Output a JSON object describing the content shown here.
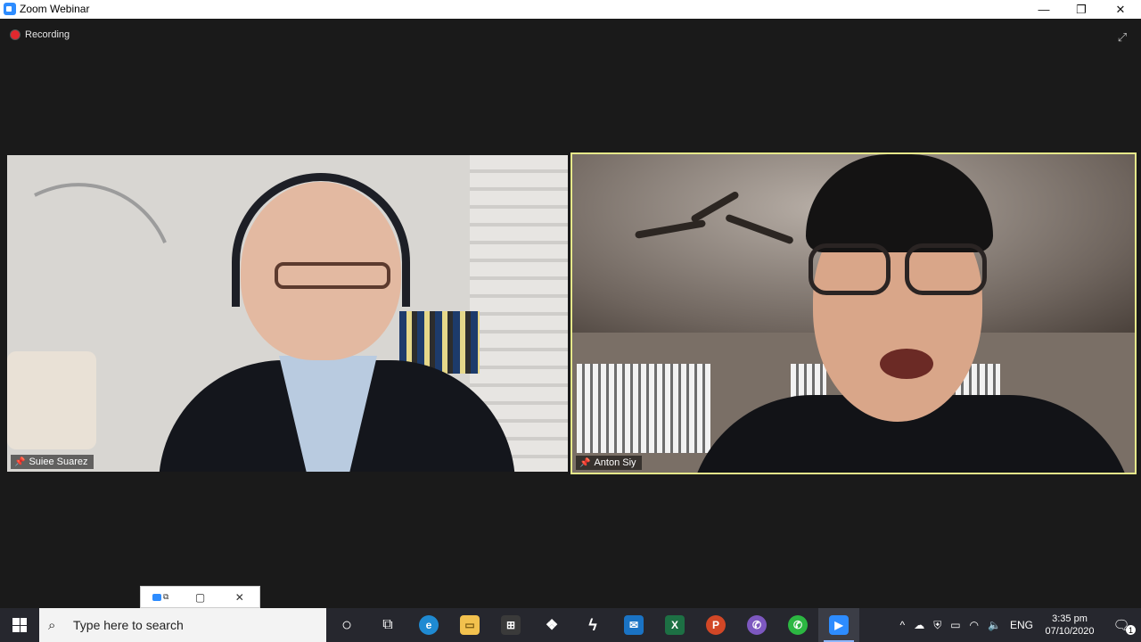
{
  "window": {
    "title": "Zoom Webinar",
    "minimize": "—",
    "maximize": "❐",
    "close": "✕"
  },
  "meeting": {
    "recording_label": "Recording",
    "fullscreen_icon": "⤢",
    "participants": [
      {
        "name": "Suiee Suarez",
        "speaking": false
      },
      {
        "name": "Anton Siy",
        "speaking": true
      }
    ],
    "active_speaker_border": "#e6e88a",
    "recording_color": "#e0282e"
  },
  "mini_controls": {
    "restore_icon": "▢",
    "close_icon": "✕"
  },
  "taskbar": {
    "search_placeholder": "Type here to search",
    "apps": [
      {
        "name": "cortana",
        "glyph": "○"
      },
      {
        "name": "task-view",
        "glyph": "⧉"
      },
      {
        "name": "edge",
        "glyph": "e"
      },
      {
        "name": "file-explorer",
        "glyph": "▭"
      },
      {
        "name": "store",
        "glyph": "⊞"
      },
      {
        "name": "dropbox",
        "glyph": "❖"
      },
      {
        "name": "app-bolt",
        "glyph": "ϟ"
      },
      {
        "name": "mail",
        "glyph": "✉"
      },
      {
        "name": "excel",
        "glyph": "X"
      },
      {
        "name": "powerpoint",
        "glyph": "P"
      },
      {
        "name": "viber",
        "glyph": "✆"
      },
      {
        "name": "whatsapp",
        "glyph": "✆"
      },
      {
        "name": "zoom",
        "glyph": "▶"
      }
    ],
    "tray": {
      "chevron": "^",
      "language": "ENG",
      "time": "3:35 pm",
      "date": "07/10/2020",
      "notification_count": "1"
    }
  }
}
